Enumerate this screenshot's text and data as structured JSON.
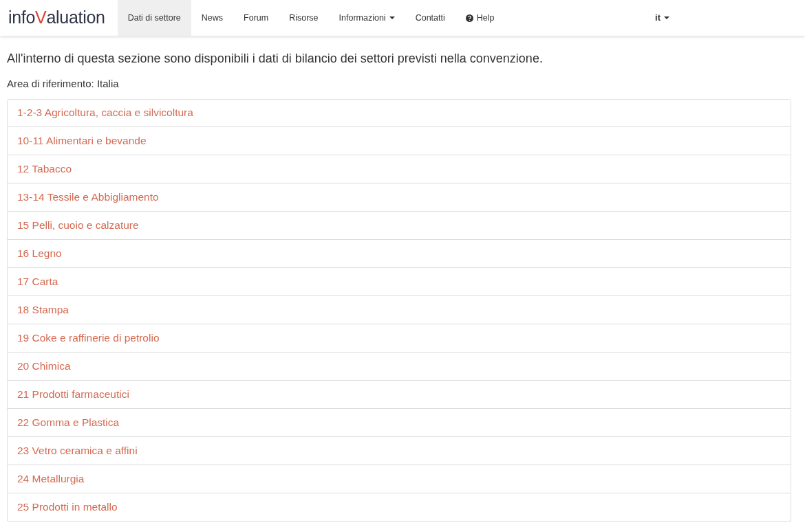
{
  "logo": {
    "before": "info",
    "accent": "V",
    "after": "aluation"
  },
  "nav": [
    {
      "label": "Dati di settore",
      "selected": true,
      "kind": "link"
    },
    {
      "label": "News",
      "selected": false,
      "kind": "link"
    },
    {
      "label": "Forum",
      "selected": false,
      "kind": "link"
    },
    {
      "label": "Risorse",
      "selected": false,
      "kind": "link"
    },
    {
      "label": "Informazioni",
      "selected": false,
      "kind": "dropdown"
    },
    {
      "label": "Contatti",
      "selected": false,
      "kind": "link"
    },
    {
      "label": "Help",
      "selected": false,
      "kind": "help"
    }
  ],
  "language": {
    "label": "it"
  },
  "intro": "All'interno di questa sezione sono disponibili i dati di bilancio dei settori previsti nella convenzione.",
  "area": "Area di riferimento: Italia",
  "sectors": [
    "1-2-3 Agricoltura, caccia e silvicoltura",
    "10-11 Alimentari e bevande",
    "12 Tabacco",
    "13-14 Tessile e Abbigliamento",
    "15 Pelli, cuoio e calzature",
    "16 Legno",
    "17 Carta",
    "18 Stampa",
    "19 Coke e raffinerie di petrolio",
    "20 Chimica",
    "21 Prodotti farmaceutici",
    "22 Gomma e Plastica",
    "23 Vetro ceramica e affini",
    "24 Metallurgia",
    "25 Prodotti in metallo"
  ]
}
